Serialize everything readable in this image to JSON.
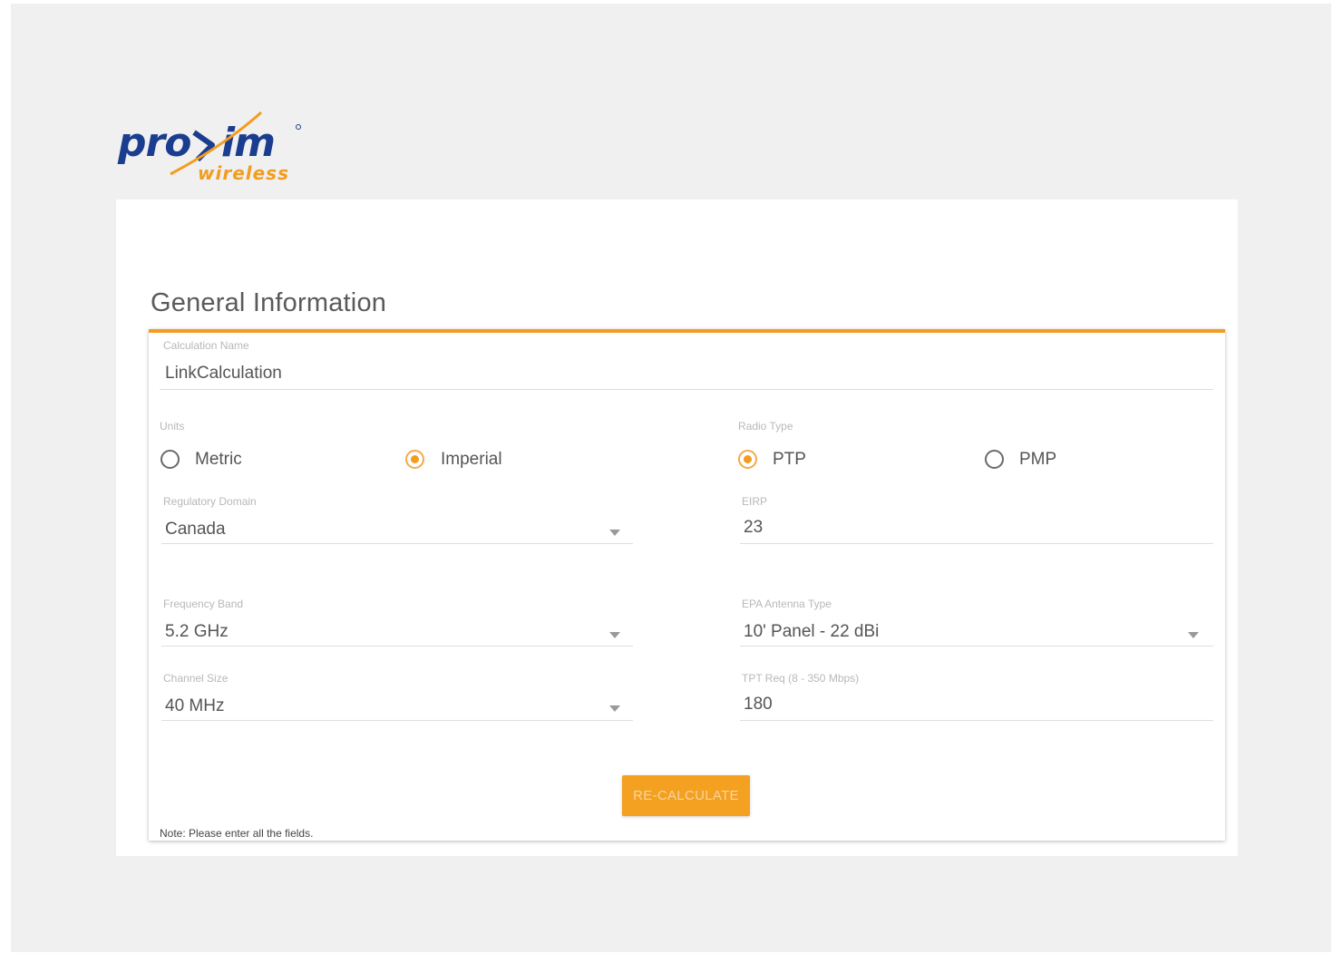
{
  "brand": {
    "name": "proxim",
    "tagline": "wireless",
    "primary_color": "#1b3d8f",
    "accent_color": "#f39c1f"
  },
  "section": {
    "title": "General Information"
  },
  "calculation_name": {
    "label": "Calculation Name",
    "value": "LinkCalculation"
  },
  "units": {
    "label": "Units",
    "options": [
      {
        "label": "Metric",
        "checked": false
      },
      {
        "label": "Imperial",
        "checked": true
      }
    ]
  },
  "radio_type": {
    "label": "Radio Type",
    "options": [
      {
        "label": "PTP",
        "checked": true
      },
      {
        "label": "PMP",
        "checked": false
      }
    ]
  },
  "regulatory_domain": {
    "label": "Regulatory Domain",
    "value": "Canada"
  },
  "eirp": {
    "label": "EIRP",
    "value": "23"
  },
  "frequency_band": {
    "label": "Frequency Band",
    "value": "5.2 GHz"
  },
  "epa_antenna_type": {
    "label": "EPA Antenna Type",
    "value": "10' Panel - 22 dBi"
  },
  "channel_size": {
    "label": "Channel Size",
    "value": "40 MHz"
  },
  "tpt_req": {
    "label": "TPT Req (8 - 350 Mbps)",
    "value": "180"
  },
  "actions": {
    "recalculate": "RE-CALCULATE"
  },
  "note": "Note: Please enter all the fields."
}
